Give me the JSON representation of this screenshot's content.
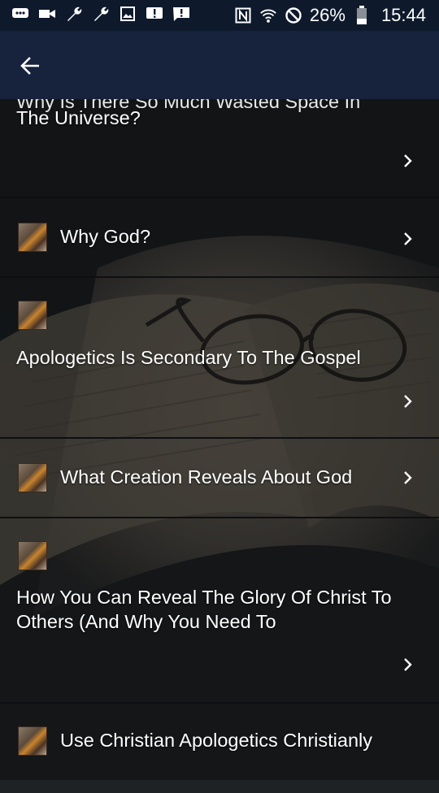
{
  "status_bar": {
    "battery_percent": "26%",
    "time": "15:44",
    "icons": [
      "message-icon",
      "video-icon",
      "wrench-icon",
      "wrench-icon",
      "image-icon",
      "alert-icon",
      "alert-message-icon",
      "nfc-icon",
      "wifi-icon",
      "do-not-disturb-icon",
      "battery-icon"
    ]
  },
  "app_bar": {
    "back_icon": "arrow-left-icon"
  },
  "list": {
    "items": [
      {
        "title_cut": "Why Is There So Much Wasted Space In",
        "title": "The Universe?"
      },
      {
        "title": "Why God?"
      },
      {
        "title": "Apologetics Is Secondary To The Gospel"
      },
      {
        "title": "What Creation Reveals About God"
      },
      {
        "title": "How You Can Reveal The Glory Of Christ To Others (And Why You Need To"
      },
      {
        "title": "Use Christian Apologetics Christianly"
      }
    ]
  },
  "colors": {
    "status_bar": "#0e1a2c",
    "app_bar": "#17223c",
    "divider": "#0d0f12",
    "text": "#ffffff"
  }
}
